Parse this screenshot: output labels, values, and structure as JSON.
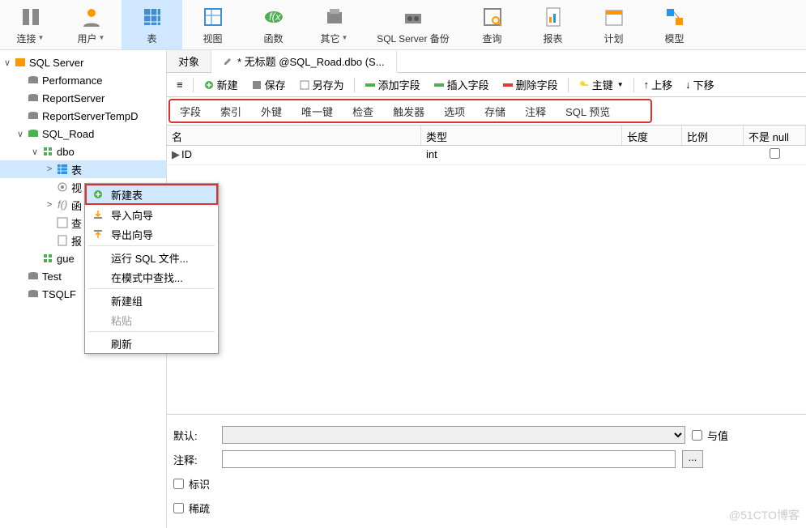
{
  "toolbar": [
    {
      "label": "连接",
      "name": "connect",
      "arrow": true
    },
    {
      "label": "用户",
      "name": "user",
      "arrow": true
    },
    {
      "label": "表",
      "name": "table",
      "active": true
    },
    {
      "label": "视图",
      "name": "view"
    },
    {
      "label": "函数",
      "name": "function"
    },
    {
      "label": "其它",
      "name": "other",
      "arrow": true
    },
    {
      "label": "SQL Server 备份",
      "name": "backup"
    },
    {
      "label": "查询",
      "name": "query"
    },
    {
      "label": "报表",
      "name": "report"
    },
    {
      "label": "计划",
      "name": "schedule"
    },
    {
      "label": "模型",
      "name": "model"
    }
  ],
  "tree": [
    {
      "indent": 0,
      "toggle": "∨",
      "icon": "server",
      "label": "SQL Server",
      "name": "node-sqlserver"
    },
    {
      "indent": 1,
      "toggle": "",
      "icon": "db",
      "label": "Performance",
      "name": "node-performance"
    },
    {
      "indent": 1,
      "toggle": "",
      "icon": "db",
      "label": "ReportServer",
      "name": "node-reportserver"
    },
    {
      "indent": 1,
      "toggle": "",
      "icon": "db",
      "label": "ReportServerTempD",
      "name": "node-reportservertempdb"
    },
    {
      "indent": 1,
      "toggle": "∨",
      "icon": "db-green",
      "label": "SQL_Road",
      "name": "node-sqlroad"
    },
    {
      "indent": 2,
      "toggle": "∨",
      "icon": "schema",
      "label": "dbo",
      "name": "node-dbo"
    },
    {
      "indent": 3,
      "toggle": ">",
      "icon": "table",
      "label": "表",
      "name": "node-tables",
      "selected": true
    },
    {
      "indent": 3,
      "toggle": "",
      "icon": "view",
      "label": "视",
      "name": "node-views"
    },
    {
      "indent": 3,
      "toggle": ">",
      "icon": "fx",
      "label": "函",
      "name": "node-functions"
    },
    {
      "indent": 3,
      "toggle": "",
      "icon": "query",
      "label": "查",
      "name": "node-queries"
    },
    {
      "indent": 3,
      "toggle": "",
      "icon": "report",
      "label": "报",
      "name": "node-reports"
    },
    {
      "indent": 2,
      "toggle": "",
      "icon": "schema",
      "label": "gue",
      "name": "node-guest"
    },
    {
      "indent": 1,
      "toggle": "",
      "icon": "db",
      "label": "Test",
      "name": "node-test"
    },
    {
      "indent": 1,
      "toggle": "",
      "icon": "db",
      "label": "TSQLF",
      "name": "node-tsqlf"
    }
  ],
  "tabs": {
    "objects": "对象",
    "untitled": "* 无标题 @SQL_Road.dbo (S..."
  },
  "actions": {
    "new": "新建",
    "save": "保存",
    "saveas": "另存为",
    "addfield": "添加字段",
    "insertfield": "插入字段",
    "deletefield": "删除字段",
    "primarykey": "主键",
    "moveup": "上移",
    "movedown": "下移"
  },
  "subtabs": [
    "字段",
    "索引",
    "外键",
    "唯一键",
    "检查",
    "触发器",
    "选项",
    "存储",
    "注释",
    "SQL 预览"
  ],
  "grid": {
    "headers": {
      "name": "名",
      "type": "类型",
      "length": "长度",
      "scale": "比例",
      "notnull": "不是 null"
    },
    "rows": [
      {
        "name": "ID",
        "type": "int",
        "notnull": false
      }
    ]
  },
  "form": {
    "default_label": "默认:",
    "comment_label": "注释:",
    "withvalue_label": "与值",
    "identity_label": "标识",
    "sparse_label": "稀疏"
  },
  "context_menu": [
    {
      "label": "新建表",
      "name": "ctx-new-table",
      "icon": "plus",
      "hover": true
    },
    {
      "label": "导入向导",
      "name": "ctx-import",
      "icon": "import"
    },
    {
      "label": "导出向导",
      "name": "ctx-export",
      "icon": "export"
    },
    {
      "sep": true
    },
    {
      "label": "运行 SQL 文件...",
      "name": "ctx-runsql"
    },
    {
      "label": "在模式中查找...",
      "name": "ctx-find"
    },
    {
      "sep": true
    },
    {
      "label": "新建组",
      "name": "ctx-newgroup"
    },
    {
      "label": "粘贴",
      "name": "ctx-paste",
      "disabled": true
    },
    {
      "sep": true
    },
    {
      "label": "刷新",
      "name": "ctx-refresh"
    }
  ],
  "watermark": "@51CTO博客"
}
